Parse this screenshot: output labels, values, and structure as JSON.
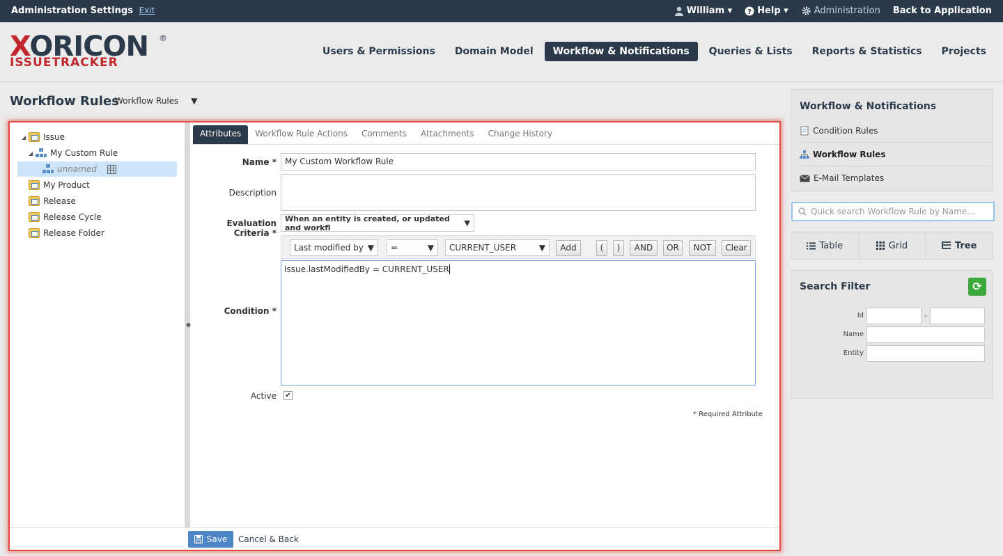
{
  "topbar": {
    "title": "Administration Settings",
    "exit": "Exit",
    "user": "William ▾",
    "help": "Help ▾",
    "admin": "Administration",
    "back": "Back to Application"
  },
  "logo": {
    "brand_x": "X",
    "brand_rest": "ORICON",
    "reg": "®",
    "sub": "ISSUETRACKER"
  },
  "nav": {
    "tabs": [
      "Users & Permissions",
      "Domain Model",
      "Workflow & Notifications",
      "Queries & Lists",
      "Reports & Statistics",
      "Projects"
    ]
  },
  "page": {
    "title": "Workflow Rules",
    "selector": "Workflow Rules",
    "selector_arrow": "▼"
  },
  "tree": {
    "nodes": [
      {
        "label": "Issue",
        "toggle": "◢"
      },
      {
        "label": "My Custom Rule",
        "toggle": "◢"
      },
      {
        "label": "unnamed"
      },
      {
        "label": "My Product"
      },
      {
        "label": "Release"
      },
      {
        "label": "Release Cycle"
      },
      {
        "label": "Release Folder"
      }
    ]
  },
  "tabs": [
    "Attributes",
    "Workflow Rule Actions",
    "Comments",
    "Attachments",
    "Change History"
  ],
  "form": {
    "name_label": "Name *",
    "name_value": "My Custom Workflow Rule",
    "description_label": "Description",
    "description_value": "",
    "criteria_label": "Evaluation Criteria *",
    "criteria_value": "When an entity is created, or updated and workfl",
    "cond_field": "Last modified by",
    "cond_op": "=",
    "cond_value": "CURRENT_USER",
    "add": "Add",
    "lparen": "(",
    "rparen": ")",
    "and": "AND",
    "or": "OR",
    "not": "NOT",
    "clear": "Clear",
    "condition_label": "Condition *",
    "condition_value": "Issue.lastModifiedBy = CURRENT_USER",
    "active_label": "Active",
    "active_mark": "✔",
    "required_note": "* Required Attribute"
  },
  "footer": {
    "save": "Save",
    "cancel": "Cancel & Back"
  },
  "sidebar": {
    "title": "Workflow & Notifications",
    "links": [
      "Condition Rules",
      "Workflow Rules",
      "E-Mail Templates"
    ],
    "search_placeholder": "Quick search Workflow Rule by Name...",
    "views": [
      "Table",
      "Grid",
      "Tree"
    ],
    "filter_title": "Search Filter",
    "filter_id": "Id",
    "filter_dash": "-",
    "filter_name": "Name",
    "filter_entity": "Entity"
  },
  "colors": {
    "primary": "#2b3a4a",
    "accent_red": "#c0282d",
    "highlight": "#e4473d",
    "save_blue": "#4e85c7"
  }
}
